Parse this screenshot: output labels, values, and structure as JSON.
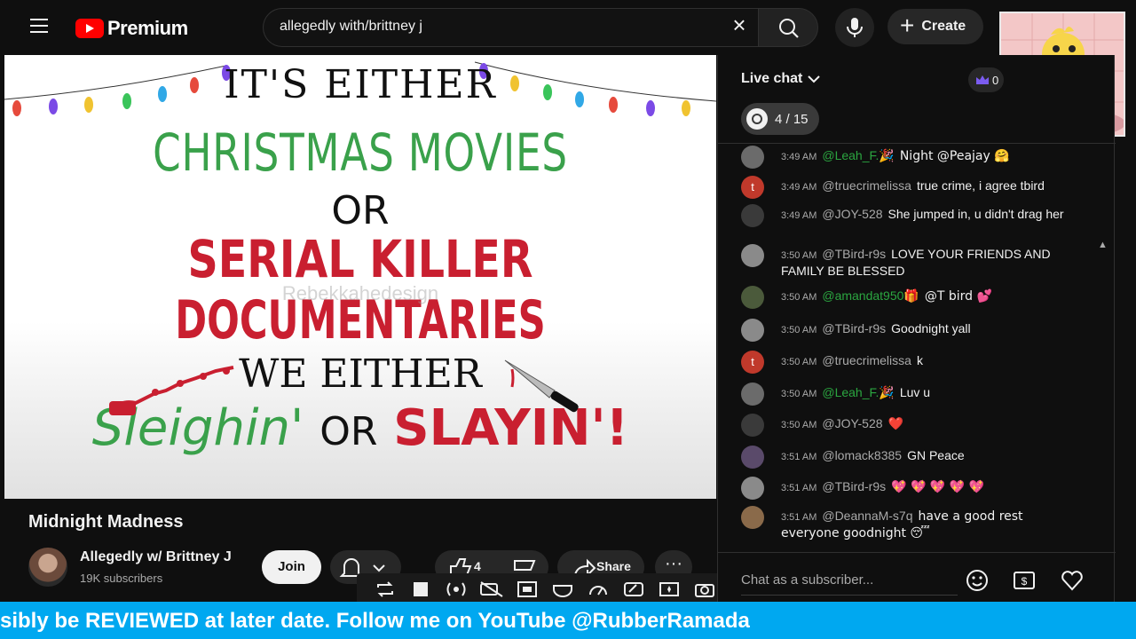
{
  "header": {
    "logo_text": "Premium",
    "search_value": "allegedly with/brittney j",
    "clear_glyph": "×",
    "create_label": "Create"
  },
  "video": {
    "poster": {
      "line1": "IT'S EITHER",
      "line2": "CHRISTMAS MOVIES",
      "line3": "OR",
      "line4": "SERIAL KILLER",
      "line5": "DOCUMENTARIES",
      "line6": "WE EITHER",
      "line7a": "Sleighin'",
      "line7b": "OR",
      "line7c": "SLAYIN'!",
      "watermark": "Rebekkahedesign"
    },
    "title": "Midnight Madness",
    "channel_name": "Allegedly w/ Brittney J",
    "channel_subs": "19K subscribers",
    "join_label": "Join",
    "like_count": "4",
    "share_label": "Share",
    "more_glyph": "···"
  },
  "chat": {
    "title": "Live chat",
    "crown_count": "0",
    "goal_text": "4 / 15",
    "input_placeholder": "Chat as a subscriber...",
    "messages": [
      {
        "time": "3:49 AM",
        "author": "@Leah_F.🎉",
        "text": "Night @Peajay 🤗",
        "member": true,
        "avatar_color": "#6b6b6b"
      },
      {
        "time": "3:49 AM",
        "author": "@truecrimelissa",
        "text": "true crime, i agree tbird",
        "member": false,
        "avatar_color": "#c0392b",
        "initial": "t"
      },
      {
        "time": "3:49 AM",
        "author": "@JOY-528",
        "text": "She jumped in, u didn't drag her",
        "member": false,
        "avatar_color": "#3a3a3a"
      },
      {
        "time": "3:50 AM",
        "author": "@TBird-r9s",
        "text": "LOVE YOUR FRIENDS AND FAMILY BE BLESSED",
        "member": false,
        "avatar_color": "#8a8a8a"
      },
      {
        "time": "3:50 AM",
        "author": "@amandat950🎁",
        "text": "@T bird 💕",
        "member": true,
        "avatar_color": "#4b5a3b"
      },
      {
        "time": "3:50 AM",
        "author": "@TBird-r9s",
        "text": "Goodnight yall",
        "member": false,
        "avatar_color": "#8a8a8a"
      },
      {
        "time": "3:50 AM",
        "author": "@truecrimelissa",
        "text": "k",
        "member": false,
        "avatar_color": "#c0392b",
        "initial": "t"
      },
      {
        "time": "3:50 AM",
        "author": "@Leah_F.🎉",
        "text": "Luv u",
        "member": true,
        "avatar_color": "#6b6b6b"
      },
      {
        "time": "3:50 AM",
        "author": "@JOY-528",
        "text": "❤️",
        "member": false,
        "avatar_color": "#3a3a3a"
      },
      {
        "time": "3:51 AM",
        "author": "@lomack8385",
        "text": "GN Peace",
        "member": false,
        "avatar_color": "#5a4a6a"
      },
      {
        "time": "3:51 AM",
        "author": "@TBird-r9s",
        "text": "💖 💖 💖 💖 💖",
        "member": false,
        "avatar_color": "#8a8a8a"
      },
      {
        "time": "3:51 AM",
        "author": "@DeannaM-s7q",
        "text": "have a good rest everyone goodnight 😴",
        "member": false,
        "avatar_color": "#8a6a4a"
      }
    ]
  },
  "ticker": {
    "text": "sibly be REVIEWED at later date. Follow me on YouTube @RubberRamada"
  },
  "colors": {
    "accent_red": "#ff0000",
    "ticker_blue": "#00a8f0",
    "member_green": "#2ba640",
    "poster_green": "#3aa14b",
    "poster_red": "#c91f30"
  },
  "icons": [
    "menu-icon",
    "youtube-logo-icon",
    "search-icon",
    "microphone-icon",
    "plus-icon",
    "bell-icon",
    "chevron-down-icon",
    "like-icon",
    "dislike-icon",
    "share-icon",
    "crown-icon",
    "goal-icon",
    "emoji-icon",
    "super-chat-icon",
    "heart-icon",
    "record-toolbar-icons"
  ]
}
